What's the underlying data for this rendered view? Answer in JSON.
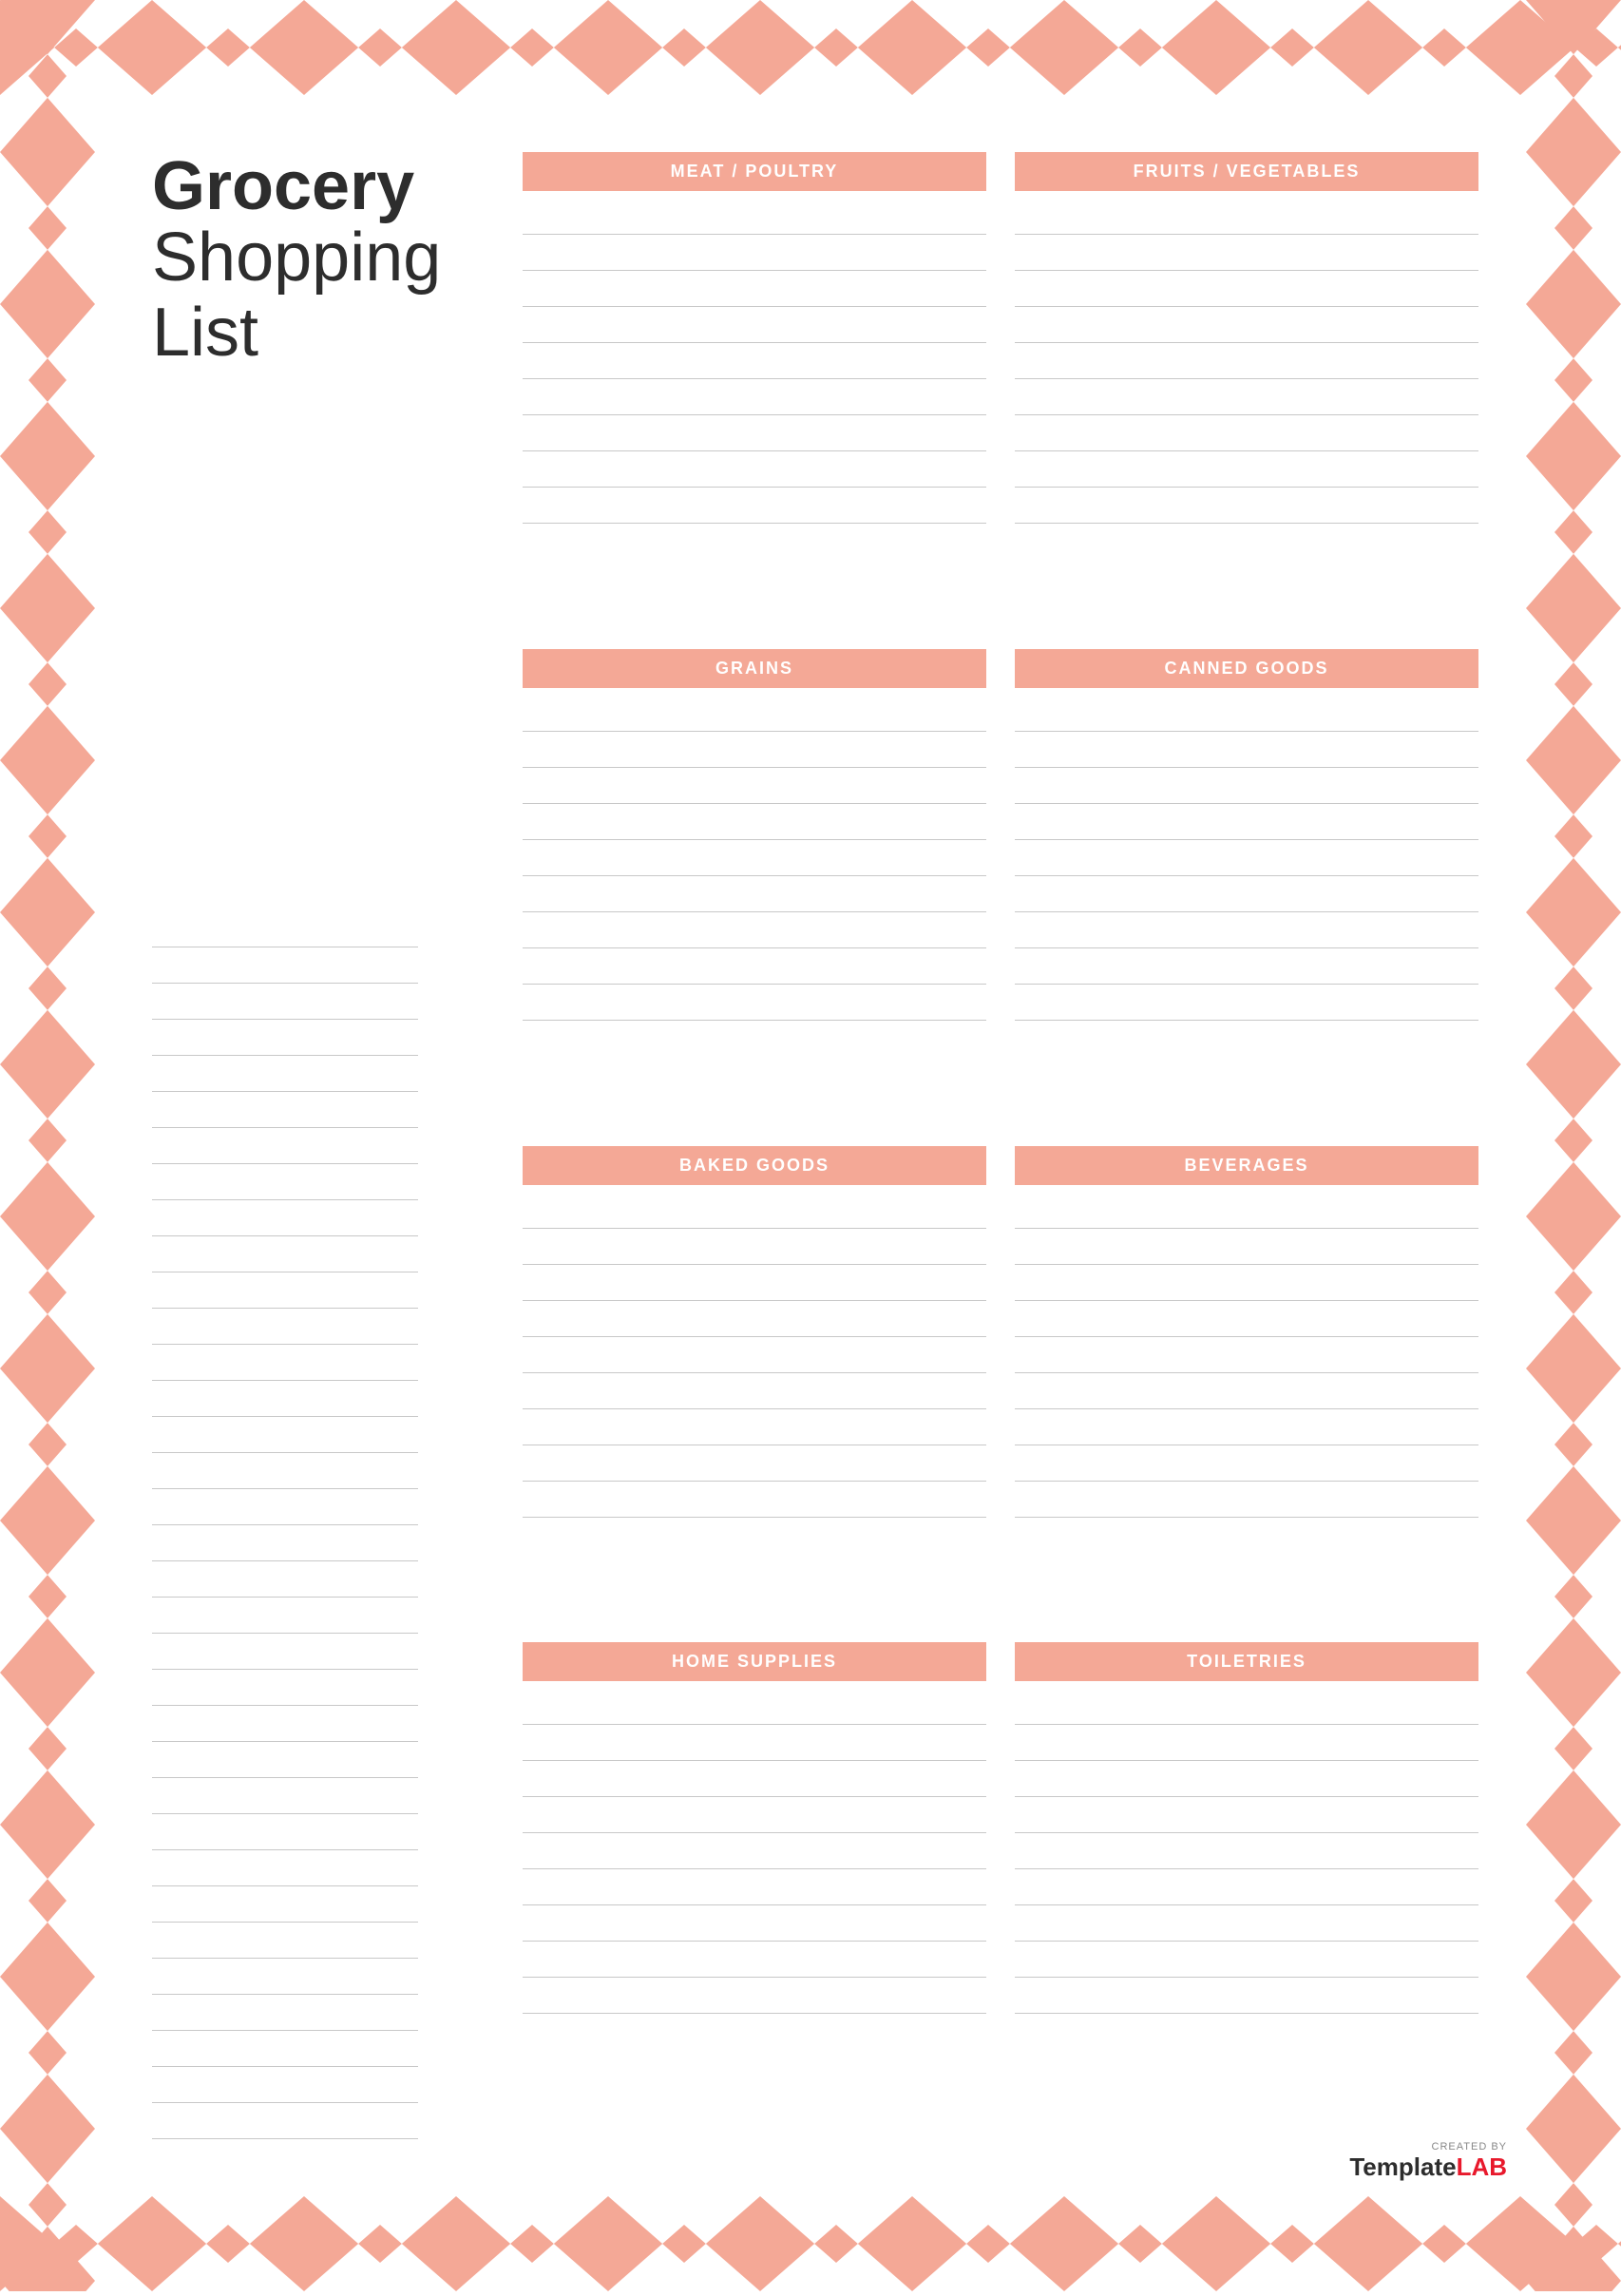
{
  "title": {
    "line1": "Grocery",
    "line2": "Shopping",
    "line3": "List"
  },
  "colors": {
    "header_bg": "#f4a896",
    "line_color": "#c8c8c8",
    "chevron_color": "#f4a896",
    "text_dark": "#2d2d2d"
  },
  "categories": {
    "row1": [
      {
        "label": "MEAT / POULTRY",
        "lines": 9
      },
      {
        "label": "FRUITS / VEGETABLES",
        "lines": 9
      }
    ],
    "row2": [
      {
        "label": "GRAINS",
        "lines": 9
      },
      {
        "label": "CANNED GOODS",
        "lines": 9
      }
    ],
    "row3": [
      {
        "label": "BAKED GOODS",
        "lines": 9
      },
      {
        "label": "BEVERAGES",
        "lines": 9
      }
    ],
    "row4": [
      {
        "label": "HOME SUPPLIES",
        "lines": 9
      },
      {
        "label": "TOILETRIES",
        "lines": 9
      }
    ]
  },
  "left_lines_count": 34,
  "footer": {
    "created_by": "CREATED BY",
    "brand_template": "Template",
    "brand_lab": "LAB"
  }
}
